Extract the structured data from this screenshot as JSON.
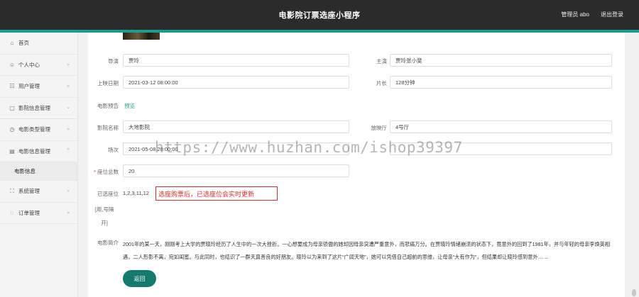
{
  "header": {
    "title": "电影院订票选座小程序",
    "user": "管理员 abo",
    "logout": "退出登录"
  },
  "sidebar": {
    "items": [
      {
        "icon": "home-icon",
        "glyph": "⌂",
        "label": "首页",
        "chevron": ""
      },
      {
        "icon": "user-icon",
        "glyph": "☺",
        "label": "个人中心",
        "chevron": "⌄"
      },
      {
        "icon": "users-icon",
        "glyph": "☷",
        "label": "用户管理",
        "chevron": "⌄"
      },
      {
        "icon": "film-info-icon",
        "glyph": "▢",
        "label": "影院信息管理",
        "chevron": "⌄"
      },
      {
        "icon": "clock-icon",
        "glyph": "◷",
        "label": "电影类型管理",
        "chevron": "⌄"
      },
      {
        "icon": "monitor-icon",
        "glyph": "▤",
        "label": "电影信息管理",
        "chevron": "⌃"
      },
      {
        "icon": "settings-icon",
        "glyph": "⛶",
        "label": "系统管理",
        "chevron": "⌄"
      },
      {
        "icon": "order-icon",
        "glyph": "◌",
        "label": "订单管理",
        "chevron": "⌄"
      }
    ],
    "sub_item": "电影信息"
  },
  "form": {
    "director_label": "导演",
    "director_value": "贾玲",
    "actor_label": "主演",
    "actor_value": "贾玲张小斐",
    "release_label": "上映日期",
    "release_value": "2021-03-12 08:00:00",
    "length_label": "片长",
    "length_value": "128分钟",
    "trailer_label": "电影预告",
    "trailer_link": "预览",
    "cinema_label": "影院名称",
    "cinema_value": "大地影院",
    "hall_label": "放映厅",
    "hall_value": "4号厅",
    "session_label": "场次",
    "session_value": "2021-05-08 20:00:00",
    "seats_req": "*",
    "seats_label": "座位总数",
    "seats_value": "20",
    "selected_label": "已选座位",
    "selected_hint": "[用,号隔开]",
    "selected_value": "1,2,3,11,12",
    "selected_note": "选座购票后，已选座位会实时更新",
    "desc_label": "电影简介",
    "desc_value": "2001年的某一天，刚刚考上大学的贾晓玲经历了人生中的一次大挫折。一心想要成为母亲骄傲的她却因母亲突遭严重意外，而悲痛万分。在贾晓玲情绪崩溃的状态下，竟意外的回到了1981年，并与年轻的母亲李焕英相遇，二人形影不离，宛如闺蜜。与此同时，也结识了一群天真善良的好朋友。晓玲以为来到了这片“广阔天地”，她可以凭借自己超前的思维，让母亲“大有作为”，但结果却让晓玲感到意外……",
    "back_label": "返回"
  },
  "watermark": "https://www.huzhan.com/ishop39397"
}
